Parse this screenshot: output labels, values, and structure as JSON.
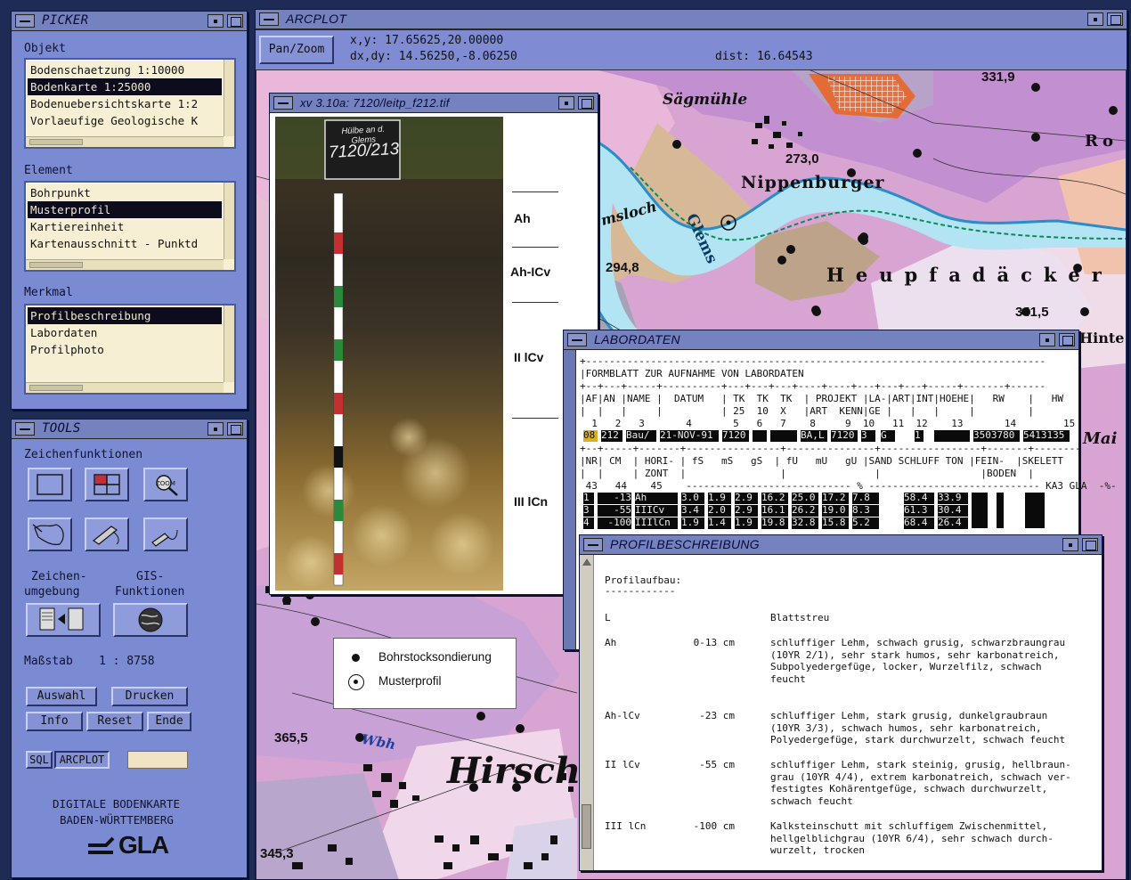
{
  "picker": {
    "title": "PICKER",
    "objekt_label": "Objekt",
    "objekt_items": [
      "Bodenschaetzung 1:10000",
      "Bodenkarte 1:25000",
      "Bodenuebersichtskarte 1:2",
      "Vorlaeufige Geologische K"
    ],
    "objekt_selected": 1,
    "element_label": "Element",
    "element_items": [
      "Bohrpunkt",
      "Musterprofil",
      "Kartiereinheit",
      "Kartenausschnitt - Punktd"
    ],
    "element_selected": 1,
    "merkmal_label": "Merkmal",
    "merkmal_items": [
      "Profilbeschreibung",
      "Labordaten",
      "Profilphoto"
    ],
    "merkmal_selected": 0
  },
  "tools": {
    "title": "TOOLS",
    "zeichen_label": "Zeichenfunktionen",
    "zeichenumgebung_l1": "Zeichen-",
    "zeichenumgebung_l2": "umgebung",
    "gis_l1": "GIS-",
    "gis_l2": "Funktionen",
    "massstab_label": "Maßstab",
    "massstab_value": "1 : 8758",
    "auswahl": "Auswahl",
    "drucken": "Drucken",
    "info": "Info",
    "reset": "Reset",
    "ende": "Ende",
    "sql": "SQL",
    "arcplot": "ARCPLOT",
    "digitale_l1": "DIGITALE BODENKARTE",
    "digitale_l2": "BADEN-WÜRTTEMBERG",
    "logo_text": "GLA"
  },
  "arcplot": {
    "title": "ARCPLOT",
    "panzoom": "Pan/Zoom",
    "xy": "x,y: 17.65625,20.00000",
    "dxdy": "dx,dy: 14.56250,-8.06250",
    "dist": "dist: 16.64543"
  },
  "map": {
    "places": [
      "Sägmühle",
      "Nippenburger",
      "Heupfadäcker",
      "Hirschl",
      "Glems",
      "Ro",
      "Hinte",
      "Mai",
      "msloch",
      "Wbh"
    ],
    "heights": [
      "331,9",
      "273,0",
      "294,8",
      "341,5",
      "365,5",
      "345,3"
    ],
    "legend_bohr": "Bohrstocksondierung",
    "legend_muster": "Musterprofil"
  },
  "xv": {
    "title": "xv 3.10a: 7120/leitp_f212.tif",
    "sign_l1": "Hülbe an d. Glems",
    "sign_l2": "7120/213",
    "horizons": [
      "Ah",
      "Ah-ICv",
      "II lCv",
      "III lCn"
    ]
  },
  "labor": {
    "title": "LABORDATEN",
    "header_line": "|FORMBLATT ZUR AUFNAHME VON LABORDATEN",
    "cols1": "|AF|AN |NAME |  DATUM   | TK  TK  TK  | PROJEKT |LA-|ART|INT|HOEHE|   RW    |   HW",
    "cols1b": "|  |   |     |          | 25  10  X   |ART  KENN|GE |   |   |     |         |",
    "nums1": "  1   2   3       4       5   6   7    8     9  10   11  12    13       14        15",
    "vals1": [
      "08",
      "212",
      "Bau/",
      "21-NOV-91",
      "7120",
      "",
      "",
      "BA,L",
      "7120",
      "3",
      "G",
      "1",
      "",
      "3503780",
      "5413135"
    ],
    "cols2": "|NR| CM  | HORI- | fS   mS   gS  | fU   mU   gU |SAND SCHLUFF TON |FEIN-  |SKELETT",
    "cols2b": "|  |     | ZONT  |                |               |                 |BODEN  |",
    "nums2": " 43   44    45    ---------------------------- % ----------------------------- KA3 GLA  -%-",
    "rows": [
      {
        "nr": "1",
        "cm": "-13",
        "hz": "Ah",
        "v": [
          "3.0",
          "1.9",
          "2.9",
          "16.2",
          "25.0",
          "17.2",
          "7.8",
          "58.4",
          "33.9"
        ]
      },
      {
        "nr": "3",
        "cm": "-55",
        "hz": "IIICv",
        "v": [
          "3.4",
          "2.0",
          "2.9",
          "16.1",
          "26.2",
          "19.0",
          "8.3",
          "61.3",
          "30.4"
        ]
      },
      {
        "nr": "4",
        "cm": "-100",
        "hz": "IIIlCn",
        "v": [
          "1.9",
          "1.4",
          "1.9",
          "19.8",
          "32.8",
          "15.8",
          "5.2",
          "68.4",
          "26.4"
        ]
      }
    ]
  },
  "profil": {
    "title": "PROFILBESCHREIBUNG",
    "heading": "Profilaufbau:",
    "underline": "------------",
    "rows": [
      {
        "hz": "L",
        "depth": "",
        "text": "Blattstreu"
      },
      {
        "hz": "Ah",
        "depth": "0-13 cm",
        "text": "schluffiger Lehm, schwach grusig, schwarzbraungrau\n(10YR 2/1), sehr stark humos, sehr karbonatreich,\nSubpolyedergefüge, locker, Wurzelfilz, schwach\nfeucht"
      },
      {
        "hz": "Ah-lCv",
        "depth": "-23 cm",
        "text": "schluffiger Lehm, stark grusig, dunkelgraubraun\n(10YR 3/3), schwach humos, sehr karbonatreich,\nPolyedergefüge, stark durchwurzelt, schwach feucht"
      },
      {
        "hz": "II lCv",
        "depth": "-55 cm",
        "text": "schluffiger Lehm, stark steinig, grusig, hellbraun-\ngrau (10YR 4/4), extrem karbonatreich, schwach ver-\nfestigtes Kohärentgefüge, schwach durchwurzelt,\nschwach feucht"
      },
      {
        "hz": "III lCn",
        "depth": "-100 cm",
        "text": "Kalksteinschutt mit schluffigem Zwischenmittel,\nhellgelblichgrau (10YR 6/4), sehr schwach durch-\nwurzelt, trocken"
      }
    ]
  }
}
